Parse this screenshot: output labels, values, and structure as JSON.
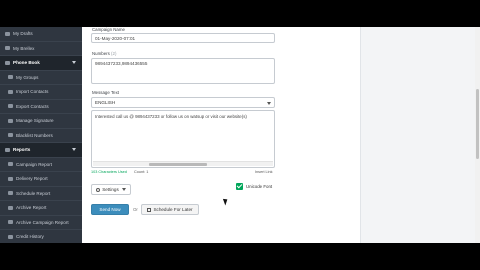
{
  "sidebar": {
    "items": [
      {
        "label": "My Drafts",
        "type": "item"
      },
      {
        "label": "My Brellex",
        "type": "item"
      },
      {
        "label": "Phone Book",
        "type": "section"
      },
      {
        "label": "My Groups",
        "type": "sub"
      },
      {
        "label": "Import Contacts",
        "type": "sub"
      },
      {
        "label": "Export Contacts",
        "type": "sub"
      },
      {
        "label": "Manage Signature",
        "type": "sub"
      },
      {
        "label": "Blacklist Numbers",
        "type": "sub"
      },
      {
        "label": "Reports",
        "type": "section"
      },
      {
        "label": "Campaign Report",
        "type": "sub"
      },
      {
        "label": "Delivery Report",
        "type": "sub"
      },
      {
        "label": "Schedule Report",
        "type": "sub"
      },
      {
        "label": "Archive Report",
        "type": "sub"
      },
      {
        "label": "Archive Campaign Report",
        "type": "sub"
      },
      {
        "label": "Credit History",
        "type": "sub"
      }
    ]
  },
  "form": {
    "campaign_label": "Campaign Name",
    "campaign_value": "01-May-2020-07:01",
    "numbers_label": "Numbers",
    "numbers_count": "(2)",
    "numbers_value": "9894437233,9894436555",
    "message_label": "Message Text",
    "language_value": "ENGLISH",
    "message_value": "Interested call us @ 9894437233 or follow us on watsup or visit our website(s)",
    "chars_used": "103 Characters Used",
    "credit_count": "Count: 1",
    "insert_link": "Insert Link",
    "settings_label": "Settings",
    "unicode_label": "Unicode Font",
    "send_label": "Send Now",
    "or_label": "Or",
    "schedule_label": "Schedule For Later"
  },
  "colors": {
    "sidebar_bg": "#2f3640",
    "primary": "#3c8dbc",
    "success": "#00a65a"
  }
}
